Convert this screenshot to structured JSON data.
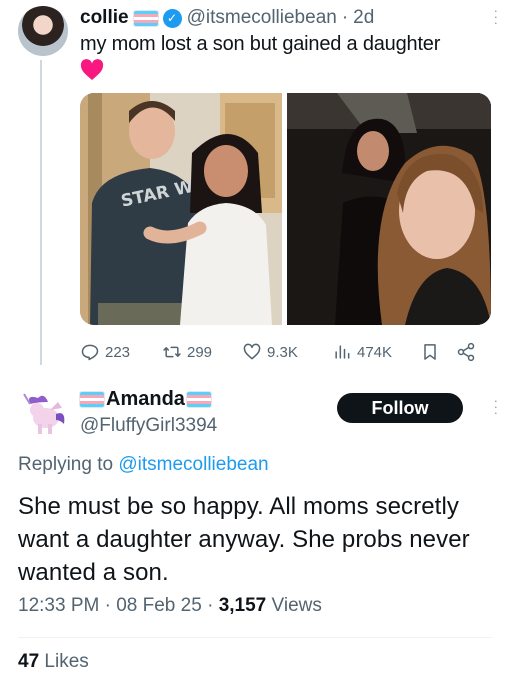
{
  "tweet": {
    "author_name": "collie",
    "handle": "@itsmecolliebean",
    "separator": "·",
    "age": "2d",
    "text": "my mom lost a son but gained a daughter",
    "emoji": "heart-emoji",
    "photos": [
      {
        "id": "left",
        "printed_text": "STAR WA"
      },
      {
        "id": "right",
        "printed_text": ""
      }
    ],
    "actions": {
      "replies": "223",
      "retweets": "299",
      "likes": "9.3K",
      "views": "474K"
    }
  },
  "reply": {
    "author_name": "Amanda",
    "handle": "@FluffyGirl3394",
    "follow_label": "Follow",
    "replying_prefix": "Replying to",
    "replying_handle": "@itsmecolliebean",
    "text": "She must be so happy. All moms secretly want a daughter anyway. She probs never wanted a son.",
    "time": "12:33 PM",
    "date": "08 Feb 25",
    "separator": "·",
    "views_count": "3,157",
    "views_label": "Views",
    "likes_count": "47",
    "likes_label": "Likes"
  },
  "colors": {
    "accent": "#1d9bf0",
    "text": "#0f1419",
    "muted": "#536471",
    "heart": "#f91880",
    "trans_blue": "#5bcefa",
    "trans_pink": "#f5a9b8"
  }
}
